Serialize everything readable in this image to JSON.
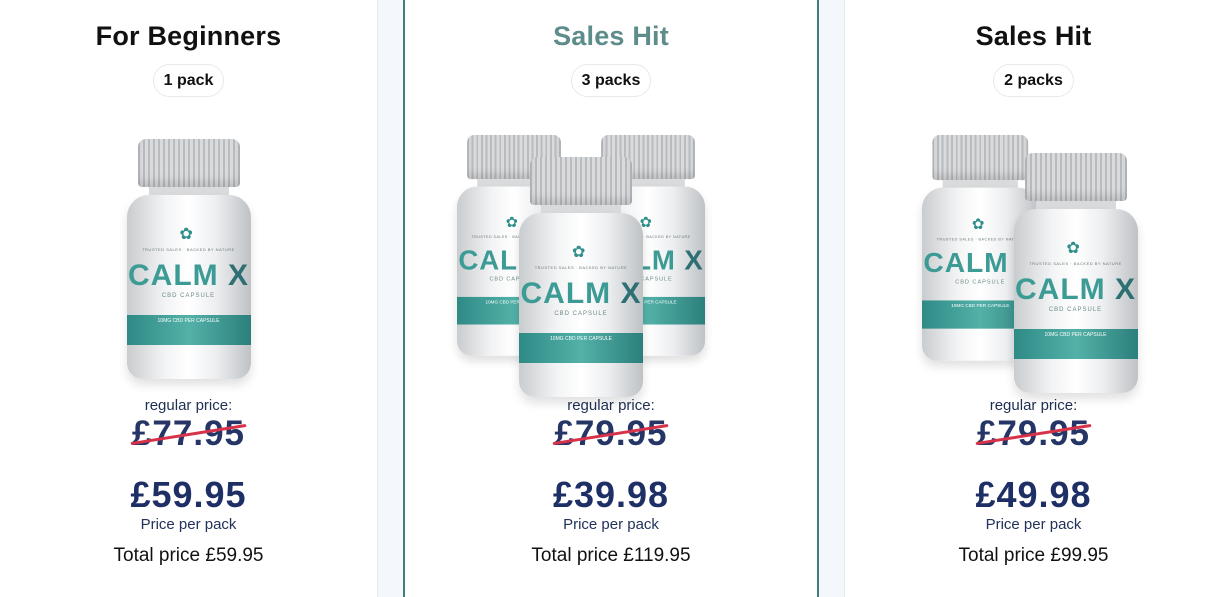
{
  "offers": [
    {
      "title": "For Beginners",
      "packs": "1 pack",
      "bottle_count": 1,
      "regular_label": "regular price:",
      "regular_price": "£77.95",
      "price": "£59.95",
      "per_pack_label": "Price per pack",
      "total": "Total price £59.95"
    },
    {
      "title": "Sales Hit",
      "packs": "3 packs",
      "bottle_count": 3,
      "regular_label": "regular price:",
      "regular_price": "£79.95",
      "price": "£39.98",
      "per_pack_label": "Price per pack",
      "total": "Total price £119.95"
    },
    {
      "title": "Sales Hit",
      "packs": "2 packs",
      "bottle_count": 2,
      "regular_label": "regular price:",
      "regular_price": "£79.95",
      "price": "£49.98",
      "per_pack_label": "Price per pack",
      "total": "Total price £99.95"
    }
  ],
  "bottle_label": {
    "brand": "CALM",
    "brand_x": "X",
    "subtitle": "CBD CAPSULE",
    "band_text": "10MG CBD PER CAPSULE",
    "tagline": "TRUSTED SALES · BACKED BY NATURE",
    "icon": "cannabis-leaf-icon"
  },
  "colors": {
    "accent": "#3f7f79",
    "highlight_title": "#5c8d8a",
    "price": "#1e2f66",
    "strike": "#d8324a",
    "teal_band": "#3d9b95"
  }
}
